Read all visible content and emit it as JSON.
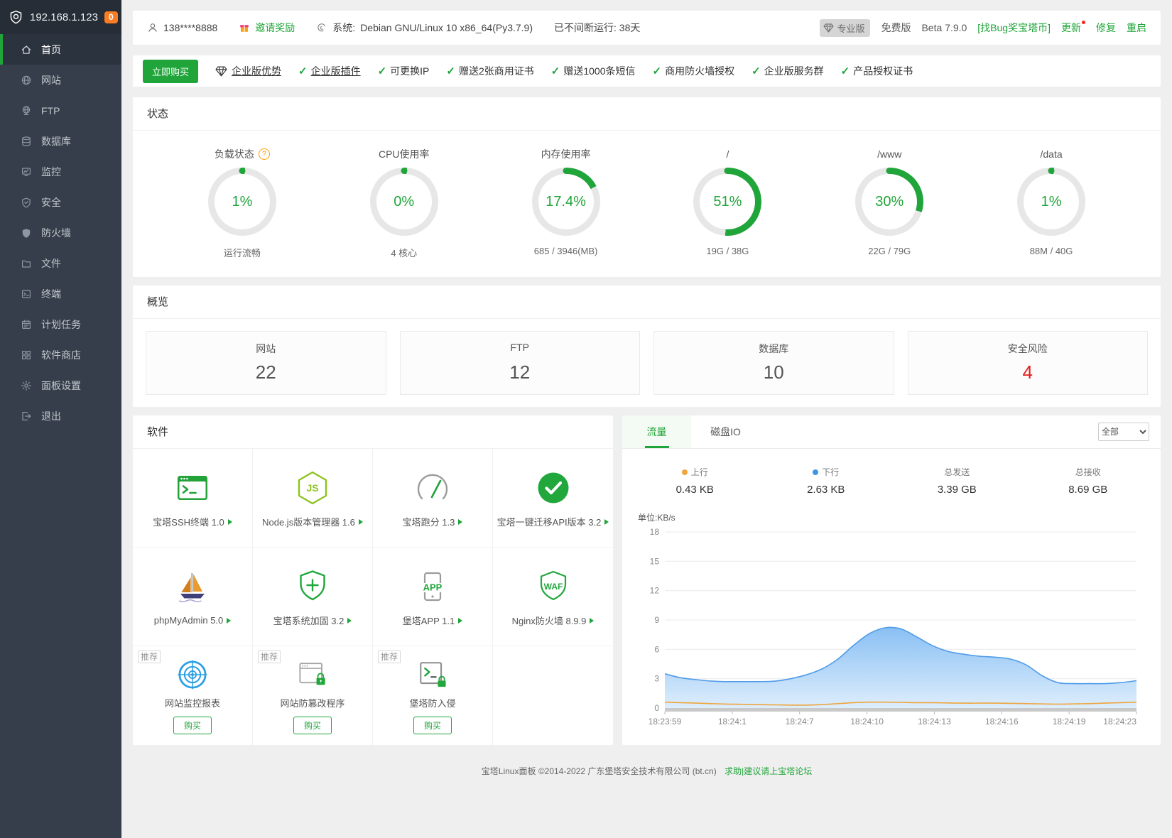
{
  "colors": {
    "accent": "#20a53a",
    "badge_orange": "#fb7c22",
    "alert_red": "#e61e1e",
    "up_dot": "#efa53d",
    "down_dot": "#3f95e5"
  },
  "sidebar": {
    "logo_icon": "bt-shield-icon",
    "server_ip": "192.168.1.123",
    "badge_count": "0",
    "items": [
      {
        "id": "home",
        "label": "首页",
        "icon": "home-icon",
        "active": true
      },
      {
        "id": "site",
        "label": "网站",
        "icon": "globe-icon",
        "active": false
      },
      {
        "id": "ftp",
        "label": "FTP",
        "icon": "ftp-globe-icon",
        "active": false
      },
      {
        "id": "database",
        "label": "数据库",
        "icon": "database-icon",
        "active": false
      },
      {
        "id": "monitor",
        "label": "监控",
        "icon": "monitor-chart-icon",
        "active": false
      },
      {
        "id": "security",
        "label": "安全",
        "icon": "shield-check-icon",
        "active": false
      },
      {
        "id": "firewall",
        "label": "防火墙",
        "icon": "firewall-shield-icon",
        "active": false
      },
      {
        "id": "files",
        "label": "文件",
        "icon": "folder-icon",
        "active": false
      },
      {
        "id": "terminal",
        "label": "终端",
        "icon": "terminal-icon",
        "active": false
      },
      {
        "id": "cron",
        "label": "计划任务",
        "icon": "calendar-icon",
        "active": false
      },
      {
        "id": "store",
        "label": "软件商店",
        "icon": "store-grid-icon",
        "active": false
      },
      {
        "id": "panel",
        "label": "面板设置",
        "icon": "gear-icon",
        "active": false
      },
      {
        "id": "logout",
        "label": "退出",
        "icon": "logout-icon",
        "active": false
      }
    ]
  },
  "header": {
    "user_phone": "138****8888",
    "invite_label": "邀请奖励",
    "system_label": "系统:",
    "system_value": "Debian GNU/Linux 10 x86_64(Py3.7.9)",
    "uptime": "已不间断运行: 38天",
    "pro_label": "专业版",
    "free_label": "免费版",
    "version": "Beta 7.9.0",
    "bug_link": "[找Bug奖宝塔币]",
    "update_label": "更新",
    "repair_label": "修复",
    "restart_label": "重启"
  },
  "promo": {
    "buy_button": "立即购买",
    "advantage_label": "企业版优势",
    "features": [
      {
        "label": "企业版插件",
        "link": true
      },
      {
        "label": "可更换IP",
        "link": false
      },
      {
        "label": "赠送2张商用证书",
        "link": false
      },
      {
        "label": "赠送1000条短信",
        "link": false
      },
      {
        "label": "商用防火墙授权",
        "link": false
      },
      {
        "label": "企业版服务群",
        "link": false
      },
      {
        "label": "产品授权证书",
        "link": false
      }
    ]
  },
  "status": {
    "title": "状态",
    "gauges": [
      {
        "title": "负载状态",
        "has_help": true,
        "percent": 1,
        "display": "1%",
        "subtitle": "运行流畅"
      },
      {
        "title": "CPU使用率",
        "has_help": false,
        "percent": 0,
        "display": "0%",
        "subtitle": "4 核心"
      },
      {
        "title": "内存使用率",
        "has_help": false,
        "percent": 17.4,
        "display": "17.4%",
        "subtitle": "685 / 3946(MB)"
      },
      {
        "title": "/",
        "has_help": false,
        "percent": 51,
        "display": "51%",
        "subtitle": "19G / 38G"
      },
      {
        "title": "/www",
        "has_help": false,
        "percent": 30,
        "display": "30%",
        "subtitle": "22G / 79G"
      },
      {
        "title": "/data",
        "has_help": false,
        "percent": 1,
        "display": "1%",
        "subtitle": "88M / 40G"
      }
    ]
  },
  "overview": {
    "title": "概览",
    "cards": [
      {
        "label": "网站",
        "value": "22",
        "alert": false
      },
      {
        "label": "FTP",
        "value": "12",
        "alert": false
      },
      {
        "label": "数据库",
        "value": "10",
        "alert": false
      },
      {
        "label": "安全风险",
        "value": "4",
        "alert": true
      }
    ]
  },
  "software": {
    "title": "软件",
    "recommend_label": "推荐",
    "cells": [
      {
        "name": "宝塔SSH终端",
        "version": "1.0",
        "icon": "ssh-terminal-icon"
      },
      {
        "name": "Node.js版本管理器",
        "version": "1.6",
        "icon": "nodejs-icon"
      },
      {
        "name": "宝塔跑分",
        "version": "1.3",
        "icon": "benchmark-gauge-icon"
      },
      {
        "name": "宝塔一键迁移API版本",
        "version": "3.2",
        "icon": "migrate-check-icon"
      },
      {
        "name": "phpMyAdmin",
        "version": "5.0",
        "icon": "phpmyadmin-sailboat-icon"
      },
      {
        "name": "宝塔系统加固",
        "version": "3.2",
        "icon": "shield-plus-icon"
      },
      {
        "name": "堡塔APP",
        "version": "1.1",
        "icon": "app-phone-icon"
      },
      {
        "name": "Nginx防火墙",
        "version": "8.9.9",
        "icon": "waf-shield-icon"
      },
      {
        "name": "网站监控报表",
        "version": "",
        "icon": "monitor-report-icon",
        "recommended": true,
        "buy_label": "购买"
      },
      {
        "name": "网站防篡改程序",
        "version": "",
        "icon": "tamper-proof-icon",
        "recommended": true,
        "buy_label": "购买"
      },
      {
        "name": "堡塔防入侵",
        "version": "",
        "icon": "intrusion-lock-icon",
        "recommended": true,
        "buy_label": "购买"
      },
      {
        "empty": true
      }
    ]
  },
  "traffic": {
    "tabs": [
      {
        "label": "流量",
        "active": true
      },
      {
        "label": "磁盘IO",
        "active": false
      }
    ],
    "filter": "全部",
    "stats": [
      {
        "label": "上行",
        "value": "0.43 KB",
        "dot": "#efa53d"
      },
      {
        "label": "下行",
        "value": "2.63 KB",
        "dot": "#3f95e5"
      },
      {
        "label": "总发送",
        "value": "3.39 GB",
        "dot": ""
      },
      {
        "label": "总接收",
        "value": "8.69 GB",
        "dot": ""
      }
    ],
    "chart_data": {
      "type": "area",
      "unit_label": "单位:KB/s",
      "ylim": [
        0,
        18
      ],
      "yticks": [
        0,
        3,
        6,
        9,
        12,
        15,
        18
      ],
      "x_tick_labels": [
        "18:23:59",
        "18:24:1",
        "18:24:7",
        "18:24:10",
        "18:24:13",
        "18:24:16",
        "18:24:19",
        "18:24:23"
      ],
      "grid": true,
      "legend_position": "top",
      "series": [
        {
          "name": "下行",
          "color": "#4f9be8",
          "fill": true,
          "fill_from": "#83bcf3",
          "fill_to": "#dcedfc",
          "values": [
            3.5,
            3.1,
            2.9,
            2.75,
            2.7,
            2.7,
            2.7,
            2.75,
            3.0,
            3.4,
            4.0,
            5.0,
            6.4,
            7.6,
            8.2,
            8.1,
            7.3,
            6.4,
            5.8,
            5.5,
            5.3,
            5.2,
            5.0,
            4.4,
            3.3,
            2.6,
            2.5,
            2.5,
            2.5,
            2.6,
            2.8
          ]
        },
        {
          "name": "上行",
          "color": "#efa53d",
          "fill": false,
          "values": [
            0.6,
            0.55,
            0.5,
            0.45,
            0.4,
            0.38,
            0.35,
            0.33,
            0.3,
            0.3,
            0.35,
            0.45,
            0.55,
            0.6,
            0.6,
            0.58,
            0.55,
            0.55,
            0.52,
            0.5,
            0.5,
            0.5,
            0.48,
            0.45,
            0.42,
            0.4,
            0.42,
            0.45,
            0.5,
            0.55,
            0.6
          ]
        }
      ]
    }
  },
  "footer": {
    "copyright": "宝塔Linux面板 ©2014-2022 广东堡塔安全技术有限公司 (bt.cn)",
    "link": "求助|建议请上宝塔论坛"
  }
}
